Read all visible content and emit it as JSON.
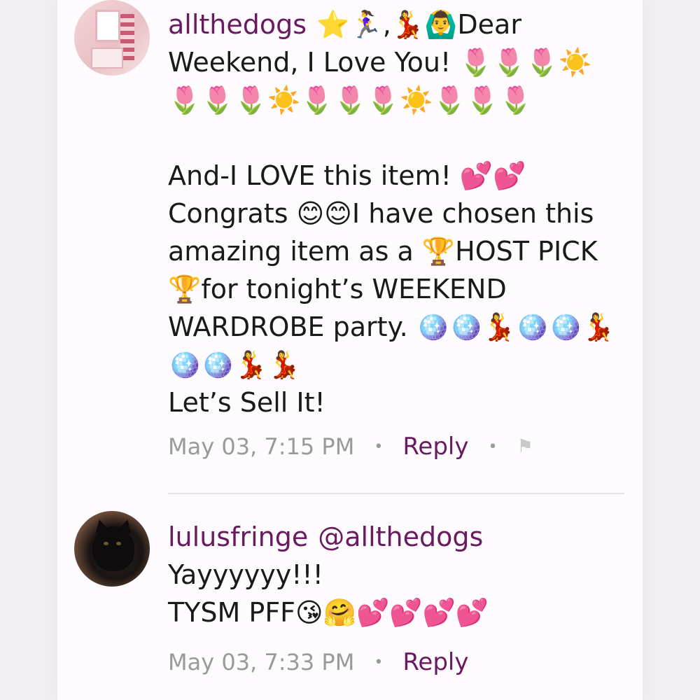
{
  "comments": [
    {
      "username": "allthedogs",
      "body": "⭐️🏃‍♀️,💃🙆‍♂️Dear Weekend, I Love You! 🌷🌷🌷☀️🌷🌷🌷☀️🌷🌷🌷☀️🌷🌷🌷\n\nAnd-I LOVE this item! 💕💕 Congrats 😊😊I have chosen this amazing item as a 🏆HOST PICK🏆for tonight’s WEEKEND WARDROBE party. 🪩🪩💃🪩🪩💃🪩🪩💃💃\nLet’s Sell It!",
      "timestamp": "May 03, 7:15 PM",
      "reply_label": "Reply",
      "has_flag": true,
      "flag_icon": "flag-icon"
    },
    {
      "username": "lulusfringe",
      "mention": "@allthedogs",
      "body": "Yayyyyyy!!!\nTYSM PFF😘🤗💕💕💕💕",
      "timestamp": "May 03, 7:33 PM",
      "reply_label": "Reply"
    }
  ],
  "colors": {
    "accent": "#6a1a5e",
    "meta_gray": "#9a9a9a",
    "background": "#fdfbfd"
  }
}
